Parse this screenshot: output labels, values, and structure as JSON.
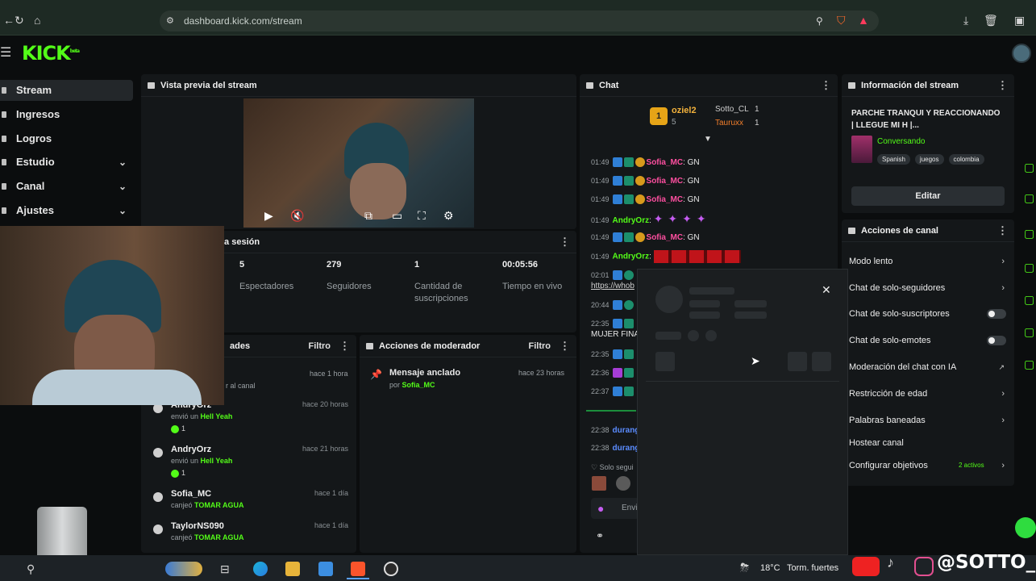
{
  "browser": {
    "url": "dashboard.kick.com/stream"
  },
  "app": {
    "logo": "KICK",
    "logo_tag": "beta"
  },
  "sidebar": {
    "items": [
      {
        "label": "Stream",
        "active": true,
        "chevron": false
      },
      {
        "label": "Ingresos",
        "active": false,
        "chevron": false
      },
      {
        "label": "Logros",
        "active": false,
        "chevron": false
      },
      {
        "label": "Estudio",
        "active": false,
        "chevron": true
      },
      {
        "label": "Canal",
        "active": false,
        "chevron": true
      },
      {
        "label": "Ajustes",
        "active": false,
        "chevron": true
      }
    ]
  },
  "preview": {
    "title": "Vista previa del stream"
  },
  "session": {
    "title": "la sesión",
    "stats": [
      {
        "value": "5",
        "label": "Espectadores"
      },
      {
        "value": "279",
        "label": "Seguidores"
      },
      {
        "value": "1",
        "label": "Cantidad de suscripciones"
      },
      {
        "value": "00:05:56",
        "label": "Tiempo en vivo"
      }
    ]
  },
  "activity": {
    "title": "ades",
    "filter": "Filtro",
    "partial_top": {
      "time": "hace 1 hora",
      "text": "r al canal"
    },
    "rows": [
      {
        "name": "AndryOrz",
        "time": "hace 20 horas",
        "action": "envió un",
        "item": "Hell Yeah",
        "count": "1"
      },
      {
        "name": "AndryOrz",
        "time": "hace 21 horas",
        "action": "envió un",
        "item": "Hell Yeah",
        "count": "1"
      },
      {
        "name": "Sofia_MC",
        "time": "hace 1 día",
        "action": "canjeó",
        "item": "TOMAR AGUA",
        "count": ""
      },
      {
        "name": "TaylorNS090",
        "time": "hace 1 día",
        "action": "canjeó",
        "item": "TOMAR AGUA",
        "count": ""
      }
    ]
  },
  "moderator": {
    "title": "Acciones de moderador",
    "filter": "Filtro",
    "entry": {
      "title": "Mensaje anclado",
      "by": "por",
      "user": "Sofia_MC",
      "time": "hace 23 horas"
    }
  },
  "chat": {
    "title": "Chat",
    "leaderboard": {
      "top": {
        "name": "oziel2",
        "value": "5",
        "rank": "1"
      },
      "others": [
        {
          "name": "Sotto_CL",
          "value": "1"
        },
        {
          "name": "Tauruxx",
          "value": "1"
        }
      ]
    },
    "messages": [
      {
        "time": "01:49",
        "user": "Sofia_MC",
        "msg": "GN"
      },
      {
        "time": "01:49",
        "user": "Sofia_MC",
        "msg": "GN"
      },
      {
        "time": "01:49",
        "user": "Sofia_MC",
        "msg": "GN"
      },
      {
        "time": "01:49",
        "user": "AndryOrz",
        "msg": ""
      },
      {
        "time": "01:49",
        "user": "Sofia_MC",
        "msg": "GN"
      },
      {
        "time": "01:49",
        "user": "AndryOrz",
        "msg": ""
      },
      {
        "time": "02:01",
        "user": "",
        "msg": ""
      },
      {
        "time": "",
        "user": "",
        "msg": "https://whob"
      },
      {
        "time": "20:44",
        "user": "",
        "msg": ""
      },
      {
        "time": "22:35",
        "user": "",
        "msg": ""
      },
      {
        "time": "",
        "user": "",
        "msg": "MUJER FINA"
      },
      {
        "time": "22:35",
        "user": "",
        "msg": ""
      },
      {
        "time": "22:36",
        "user": "",
        "msg": ""
      },
      {
        "time": "22:37",
        "user": "",
        "msg": ""
      },
      {
        "time": "22:38",
        "user": "durang",
        "msg": ""
      },
      {
        "time": "22:38",
        "user": "durang",
        "msg": ""
      }
    ],
    "followers_note": "Solo segui",
    "send_placeholder": "Envi"
  },
  "stream_info": {
    "title": "Información del stream",
    "stream_title": "PARCHE TRANQUI Y REACCIONANDO | LLEGUE MI H |...",
    "category": "Conversando",
    "tags": [
      "Spanish",
      "juegos",
      "colombia"
    ],
    "edit_label": "Editar"
  },
  "channel_actions": {
    "title": "Acciones de canal",
    "items": [
      {
        "label": "Modo lento",
        "control": "arrow"
      },
      {
        "label": "Chat de solo-seguidores",
        "control": "arrow"
      },
      {
        "label": "Chat de solo-suscriptores",
        "control": "toggle"
      },
      {
        "label": "Chat de solo-emotes",
        "control": "toggle"
      },
      {
        "label": "Moderación del chat con IA",
        "control": "external"
      },
      {
        "label": "Restricción de edad",
        "control": "arrow"
      },
      {
        "label": "Palabras baneadas",
        "control": "arrow"
      },
      {
        "label": "Hostear canal",
        "control": "none"
      },
      {
        "label": "Configurar objetivos",
        "control": "arrow",
        "extra": "2 activos"
      }
    ]
  },
  "taskbar": {
    "weather_temp": "18°C",
    "weather_text": "Torm. fuertes",
    "watermark": "@SOTTO_CL"
  },
  "colors": {
    "accent": "#53fc18",
    "bg": "#0b0d0e",
    "panel": "#141719"
  }
}
